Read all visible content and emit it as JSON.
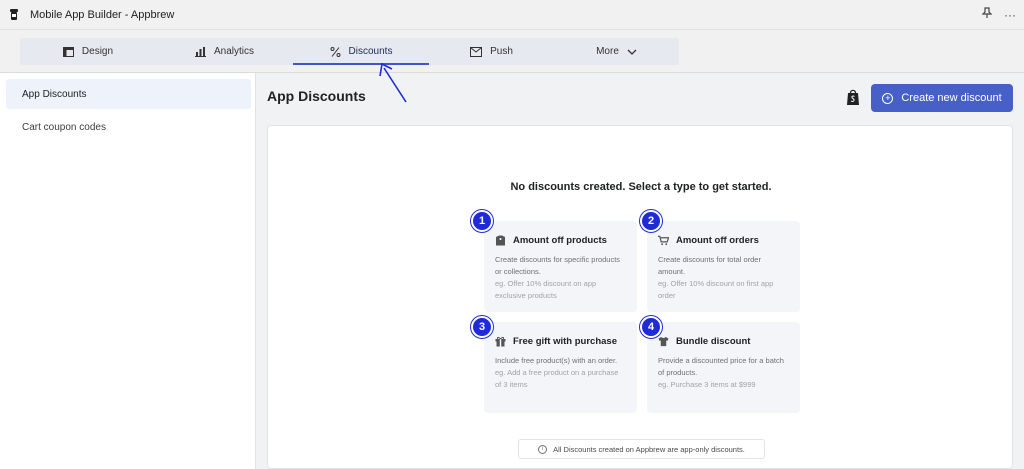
{
  "window": {
    "title": "Mobile App Builder - Appbrew",
    "more_label": "···"
  },
  "nav": {
    "tabs": [
      {
        "label": "Design",
        "icon": "layout-icon"
      },
      {
        "label": "Analytics",
        "icon": "bar-chart-icon"
      },
      {
        "label": "Discounts",
        "icon": "percent-icon",
        "active": true
      },
      {
        "label": "Push",
        "icon": "mail-icon"
      },
      {
        "label": "More",
        "icon": "chevron-down-icon"
      }
    ]
  },
  "sidebar": {
    "items": [
      {
        "label": "App Discounts",
        "active": true
      },
      {
        "label": "Cart coupon codes"
      }
    ]
  },
  "main": {
    "title": "App Discounts",
    "create_button": "Create new discount",
    "empty_title": "No discounts created. Select a type to get started.",
    "types": [
      {
        "number": "1",
        "title": "Amount off products",
        "icon": "tag-icon",
        "desc": "Create discounts for specific products or collections.",
        "eg": "eg. Offer 10% discount on app exclusive products"
      },
      {
        "number": "2",
        "title": "Amount off orders",
        "icon": "cart-icon",
        "desc": "Create discounts for total order amount.",
        "eg": "eg. Offer 10% discount on first app order"
      },
      {
        "number": "3",
        "title": "Free gift with purchase",
        "icon": "gift-icon",
        "desc": "Include free product(s) with an order.",
        "eg": "eg. Add a free product on a purchase of 3 items"
      },
      {
        "number": "4",
        "title": "Bundle discount",
        "icon": "shirt-icon",
        "desc": "Provide a discounted price for a batch of products.",
        "eg": "eg. Purchase 3 items at $999"
      }
    ],
    "info_note": "All Discounts created on Appbrew are app-only discounts."
  },
  "colors": {
    "accent": "#4760c8",
    "badge": "#1e2bd6",
    "annotation_arrow": "#1e2bd6"
  }
}
